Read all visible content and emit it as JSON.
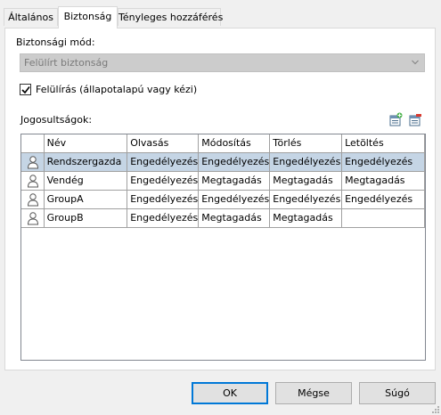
{
  "tabs": [
    "Általános",
    "Biztonság",
    "Tényleges hozzáférés"
  ],
  "security_mode": {
    "label": "Biztonsági mód:",
    "value": "Felülírt biztonság"
  },
  "override": {
    "label": "Felülírás (állapotalapú vagy kézi)",
    "checked": true
  },
  "permissions": {
    "label": "Jogosultságok:",
    "columns": [
      "",
      "Név",
      "Olvasás",
      "Módosítás",
      "Törlés",
      "Letöltés"
    ],
    "rows": [
      {
        "name": "Rendszergazda",
        "read": "Engedélyezés",
        "modify": "Engedélyezés",
        "delete": "Engedélyezés",
        "download": "Engedélyezés",
        "selected": true
      },
      {
        "name": "Vendég",
        "read": "Engedélyezés",
        "modify": "Megtagadás",
        "delete": "Megtagadás",
        "download": "Megtagadás",
        "selected": false
      },
      {
        "name": "GroupA",
        "read": "Engedélyezés",
        "modify": "Engedélyezés",
        "delete": "Engedélyezés",
        "download": "Engedélyezés",
        "selected": false
      },
      {
        "name": "GroupB",
        "read": "Engedélyezés",
        "modify": "Megtagadás",
        "delete": "Megtagadás",
        "download": "",
        "selected": false
      }
    ]
  },
  "toolbar_icons": [
    "add-permission-icon",
    "remove-permission-icon"
  ],
  "buttons": {
    "ok": "OK",
    "cancel": "Mégse",
    "help": "Súgó"
  },
  "colors": {
    "selected_row": "#c5d5e5",
    "default_button_border": "#0078d7"
  }
}
